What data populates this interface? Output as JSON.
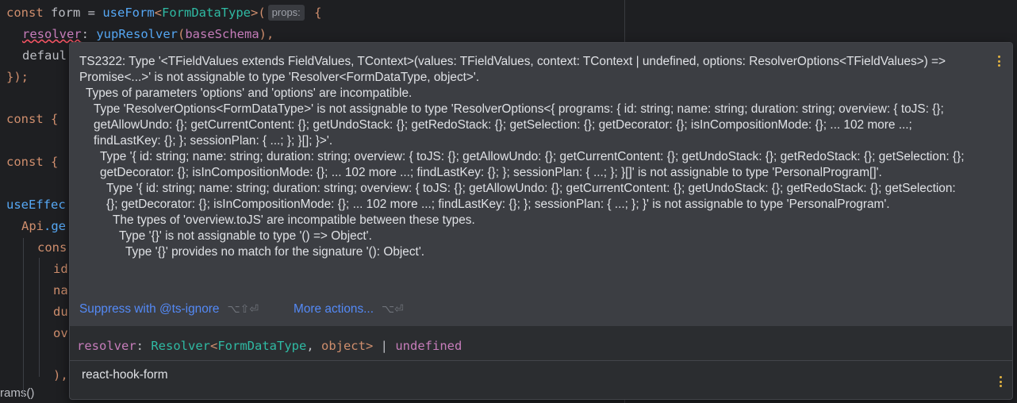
{
  "code": {
    "line1": {
      "t1": "const",
      "t2": " form = ",
      "t3": "useForm",
      "t4": "<",
      "t5": "FormDataType",
      "t6": ">(",
      "hint": "props:",
      "t7": " {"
    },
    "line2": {
      "t1": "resolver",
      "t2": ": ",
      "t3": "yupResolver",
      "t4": "(",
      "t5": "baseSchema",
      "t6": "),"
    },
    "line3": "defaul",
    "line4": "});",
    "line5": {
      "kw": "const",
      "rest": " {"
    },
    "line6": {
      "kw": "const",
      "rest": " {"
    },
    "line7": {
      "fn": "useEffec"
    },
    "line8": {
      "a": "Api",
      "b": ".ge"
    },
    "line9": "cons",
    "line10": "id",
    "line11": "na",
    "line12": "du",
    "line13": "ov",
    "line14": "),",
    "bottom": "rams()"
  },
  "popup": {
    "error_lines": [
      "TS2322: Type '<TFieldValues extends FieldValues, TContext>(values: TFieldValues, context: TContext | undefined, options: ResolverOptions<TFieldValues>) => Promise<...>' is not assignable to type 'Resolver<FormDataType, object>'.",
      "Types of parameters 'options' and 'options' are incompatible.",
      "Type 'ResolverOptions<FormDataType>' is not assignable to type 'ResolverOptions<{ programs: { id: string; name: string; duration: string; overview: { toJS: {}; getAllowUndo: {}; getCurrentContent: {}; getUndoStack: {}; getRedoStack: {}; getSelection: {}; getDecorator: {}; isInCompositionMode: {}; ... 102 more ...; findLastKey: {}; }; sessionPlan: { ...; }; }[]; }>'.",
      "Type '{ id: string; name: string; duration: string; overview: { toJS: {}; getAllowUndo: {}; getCurrentContent: {}; getUndoStack: {}; getRedoStack: {}; getSelection: {}; getDecorator: {}; isInCompositionMode: {}; ... 102 more ...; findLastKey: {}; }; sessionPlan: { ...; }; }[]' is not assignable to type 'PersonalProgram[]'.",
      "Type '{ id: string; name: string; duration: string; overview: { toJS: {}; getAllowUndo: {}; getCurrentContent: {}; getUndoStack: {}; getRedoStack: {}; getSelection: {}; getDecorator: {}; isInCompositionMode: {}; ... 102 more ...; findLastKey: {}; }; sessionPlan: { ...; }; }' is not assignable to type 'PersonalProgram'.",
      "The types of 'overview.toJS' are incompatible between these types.",
      "Type '{}' is not assignable to type '() => Object'.",
      "Type '{}' provides no match for the signature '(): Object'."
    ],
    "actions": {
      "suppress_label": "Suppress with @ts-ignore",
      "suppress_shortcut": "⌥⇧⏎",
      "more_label": "More actions...",
      "more_shortcut": "⌥⏎"
    },
    "signature": {
      "name": "resolver",
      "colon": ": ",
      "type": "Resolver",
      "lt": "<",
      "arg1": "FormDataType",
      "comma": ", ",
      "arg2": "object",
      "gt": ">",
      "pipe": " | ",
      "undef": "undefined"
    },
    "module": "react-hook-form"
  },
  "colors": {
    "editor_bg": "#1e1f22",
    "popup_bg": "#2b2d30",
    "error_panel_bg": "#3c3e43",
    "link": "#548af7",
    "keyword": "#cf8e6d",
    "function": "#56a8f5",
    "type": "#2fbaa3",
    "property": "#c77dbb",
    "menu_dots": "#e3b340"
  }
}
